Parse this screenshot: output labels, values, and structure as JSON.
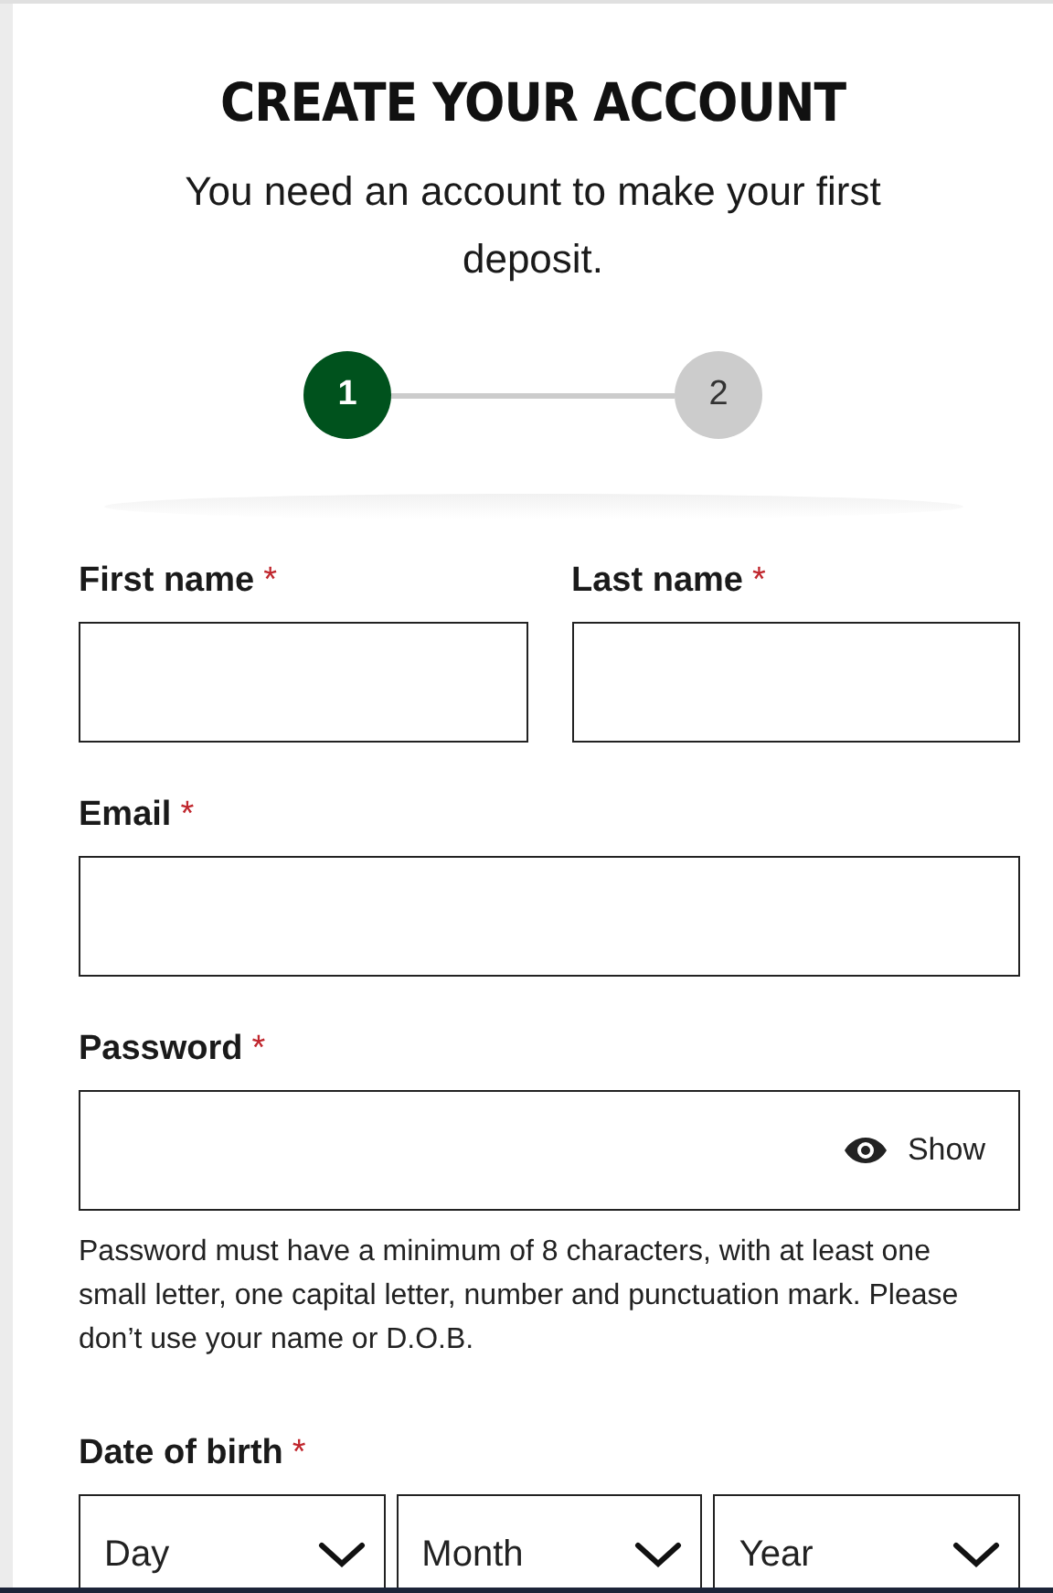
{
  "heading": "CREATE YOUR ACCOUNT",
  "intro": "You need an account to make your first deposit.",
  "steps": [
    {
      "label": "1",
      "selected": true
    },
    {
      "label": "2",
      "selected": false
    }
  ],
  "name_fields": [
    {
      "label": "First name",
      "mark": "*"
    },
    {
      "label": "Last name",
      "mark": "*"
    }
  ],
  "email": {
    "label": "Email",
    "mark": "*"
  },
  "password": {
    "label": "Password",
    "mark": "*",
    "toggle": "Show",
    "hint": "Password must have a minimum of 8 characters, with at least one small letter, one capital letter, number and punctuation mark. Please don’t use your name or D.O.B."
  },
  "date_of_birth": {
    "label": "Date of birth",
    "mark": "*",
    "selects": [
      {
        "placeholder": "Day"
      },
      {
        "placeholder": "Month"
      },
      {
        "placeholder": "Year"
      }
    ]
  }
}
